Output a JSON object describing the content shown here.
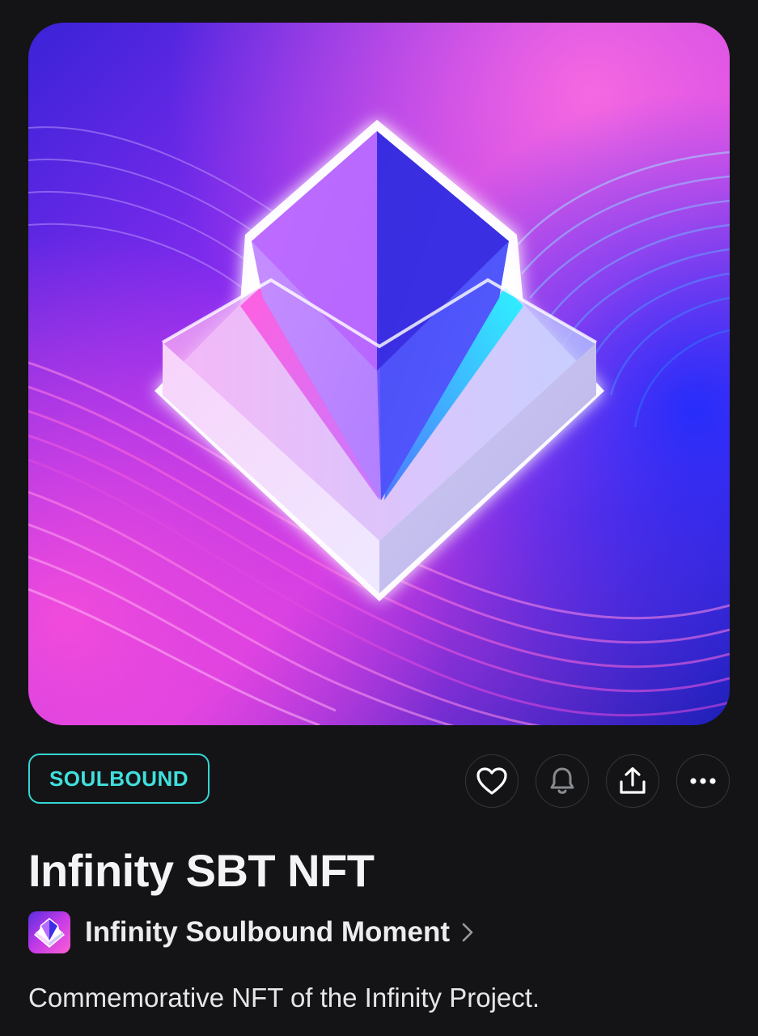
{
  "artwork": {
    "colors": {
      "magenta": "#ff4fd8",
      "violet": "#7b2ff7",
      "blue": "#2b2fd9",
      "cyan": "#36e3f5",
      "glow": "#ffffff"
    }
  },
  "badge": {
    "label": "SOULBOUND",
    "color": "#3fe0dc"
  },
  "actions": [
    {
      "id": "like",
      "icon": "heart-icon"
    },
    {
      "id": "notify",
      "icon": "bell-icon"
    },
    {
      "id": "share",
      "icon": "share-icon"
    },
    {
      "id": "more",
      "icon": "more-horizontal-icon"
    }
  ],
  "nft": {
    "title": "Infinity SBT NFT",
    "collection": {
      "name": "Infinity Soulbound Moment",
      "icon": "chevron-right-icon"
    },
    "description": "Commemorative NFT of the Infinity Project."
  }
}
